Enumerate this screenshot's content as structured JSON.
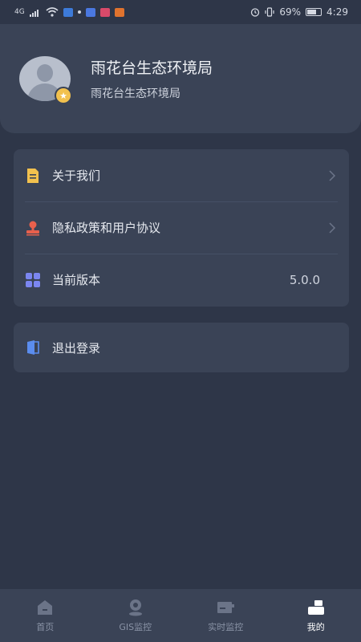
{
  "status_bar": {
    "signal_text": "4G",
    "battery": "69%",
    "battery_level": 0.69,
    "time": "4:29"
  },
  "profile": {
    "name": "雨花台生态环境局",
    "subtitle": "雨花台生态环境局",
    "avatar_icon": "user-avatar-icon",
    "badge_icon": "star-badge-icon"
  },
  "menu": {
    "items": [
      {
        "label": "关于我们",
        "icon": "document-icon",
        "icon_color": "#f2c14e"
      },
      {
        "label": "隐私政策和用户协议",
        "icon": "stamp-icon",
        "icon_color": "#e8604c"
      },
      {
        "label": "当前版本",
        "icon": "grid-apps-icon",
        "icon_color": "#7b86f0",
        "value": "5.0.0"
      }
    ]
  },
  "logout": {
    "label": "退出登录",
    "icon": "door-exit-icon",
    "icon_color": "#5b8def"
  },
  "tabs": [
    {
      "label": "首页",
      "icon": "home-icon",
      "active": false
    },
    {
      "label": "GIS监控",
      "icon": "location-pin-icon",
      "active": false
    },
    {
      "label": "实时监控",
      "icon": "monitor-icon",
      "active": false
    },
    {
      "label": "我的",
      "icon": "profile-icon",
      "active": true
    }
  ],
  "colors": {
    "background": "#2e3648",
    "card": "#3a4356",
    "text_primary": "#e6e9ef",
    "tab_inactive": "#8a93a6",
    "tab_active": "#ffffff"
  }
}
